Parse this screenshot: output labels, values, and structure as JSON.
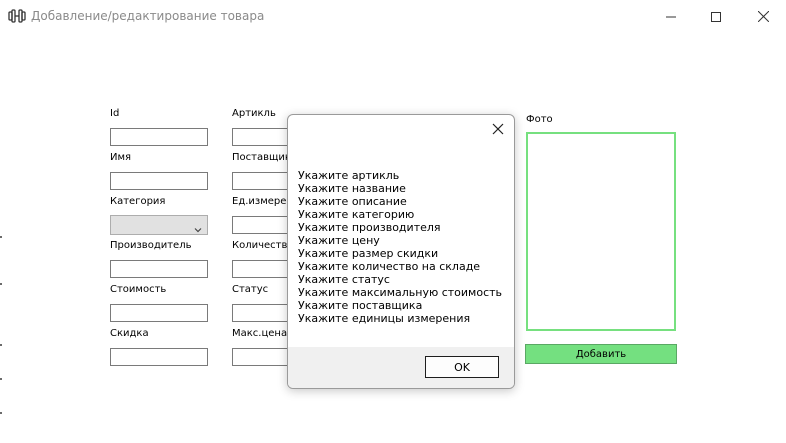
{
  "window": {
    "title": "Добавление/редактирование товара",
    "icon": "dumbbell-icon",
    "controls": [
      "minimize-icon",
      "maximize-icon",
      "close-icon"
    ]
  },
  "form": {
    "left_column": {
      "id_label": "Id",
      "name_label": "Имя",
      "category_label": "Категория",
      "manufacturer_label": "Производитель",
      "cost_label": "Стоимость",
      "discount_label": "Скидка"
    },
    "middle_column": {
      "article_label": "Артикль",
      "supplier_label": "Поставщик",
      "unit_label": "Ед.измерения",
      "quantity_label": "Количество",
      "status_label": "Статус",
      "max_price_label": "Макс.цена"
    },
    "photo_label": "Фото",
    "add_button": "Добавить",
    "accent_color": "#74e080"
  },
  "dialog": {
    "messages": [
      "Укажите артикль",
      "Укажите название",
      "Укажите описание",
      "Укажите категорию",
      "Укажите производителя",
      "Укажите цену",
      "Укажите размер скидки",
      "Укажите количество на складе",
      "Укажите статус",
      "Укажите максимальную стоимость",
      "Укажите поставщика",
      "Укажите единицы измерения"
    ],
    "ok_button": "OK"
  }
}
